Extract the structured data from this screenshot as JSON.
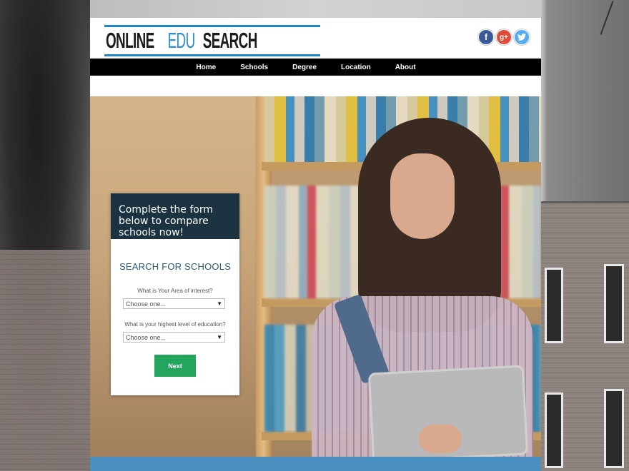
{
  "logo": {
    "part1": "ONLINE",
    "part2": "EDU",
    "part3": "SEARCH"
  },
  "social": {
    "facebook": "f",
    "google_plus": "g+",
    "twitter": "t"
  },
  "nav": {
    "items": [
      "Home",
      "Schools",
      "Degree",
      "Location",
      "About"
    ]
  },
  "form": {
    "header": "Complete the form below to compare schools now!",
    "title": "SEARCH FOR SCHOOLS",
    "q1_label": "What is Your Area of interest?",
    "q1_value": "Choose one...",
    "q2_label": "What is your highest level of education?",
    "q2_value": "Choose one...",
    "submit_label": "Next"
  },
  "colors": {
    "nav_bg": "#000000",
    "form_header_bg": "#1b3340",
    "button": "#23a55d",
    "accent": "#2b8fd6"
  }
}
